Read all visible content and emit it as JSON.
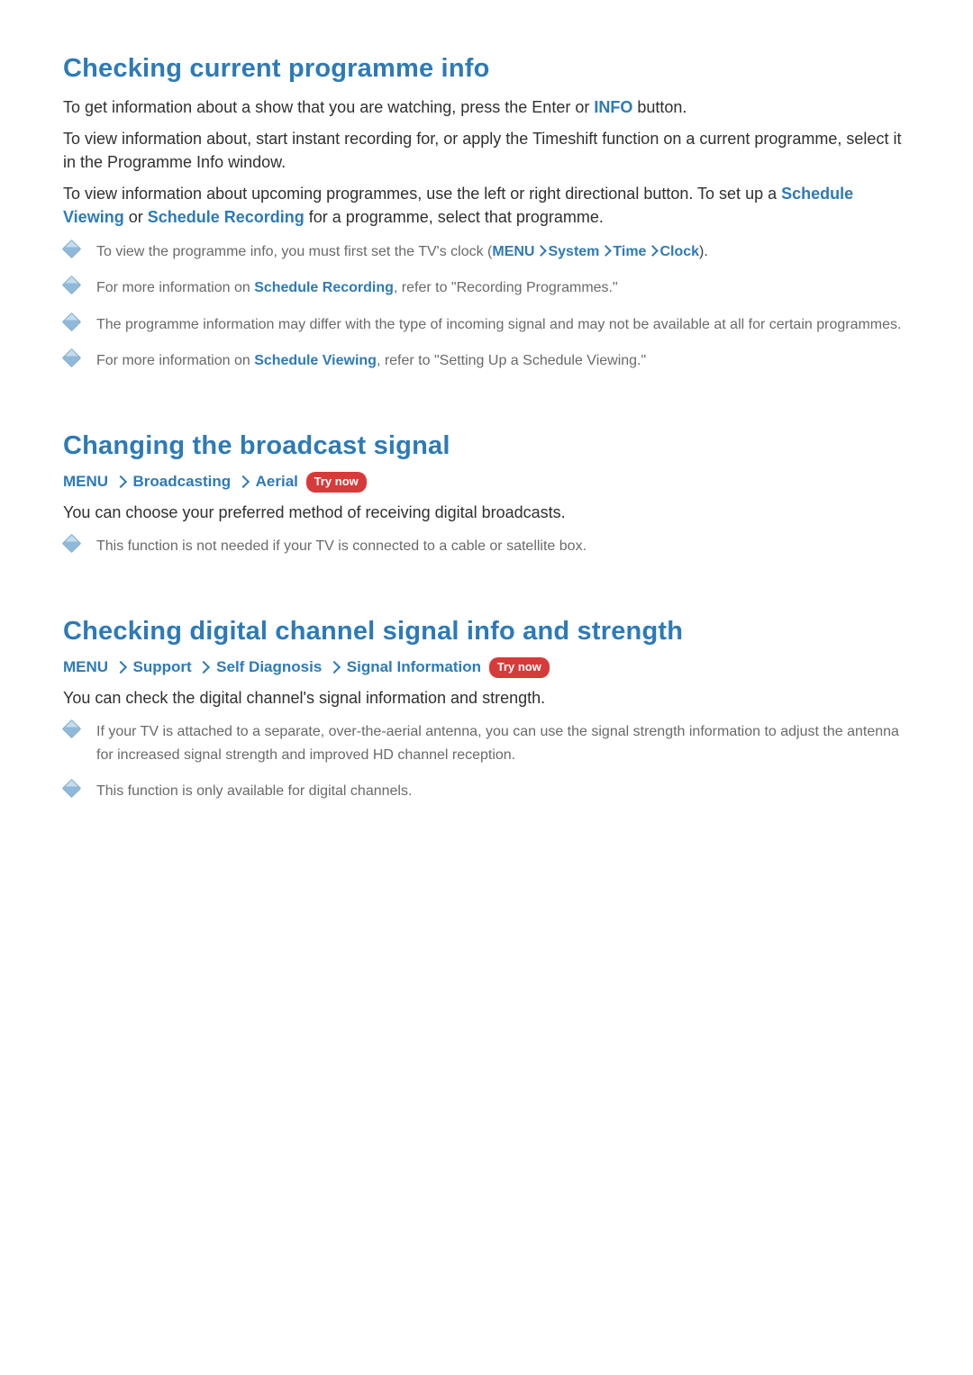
{
  "try_now_label": "Try now",
  "section1": {
    "title": "Checking current programme info",
    "p1_a": "To get information about a show that you are watching, press the Enter or ",
    "p1_info": "INFO",
    "p1_b": " button.",
    "p2": "To view information about, start instant recording for, or apply the Timeshift function on a current programme, select it in the Programme Info window.",
    "p3_a": "To view information about upcoming programmes, use the left or right directional button. To set up a ",
    "p3_sv": "Schedule Viewing",
    "p3_b": " or ",
    "p3_sr": "Schedule Recording",
    "p3_c": " for a programme, select that programme.",
    "notes": {
      "n1_a": "To view the programme info, you must first set the TV's clock (",
      "n1_menu": "MENU",
      "n1_system": "System",
      "n1_time": "Time",
      "n1_clock": "Clock",
      "n1_b": ").",
      "n2_a": "For more information on ",
      "n2_link": "Schedule Recording",
      "n2_b": ", refer to \"Recording Programmes.\"",
      "n3": "The programme information may differ with the type of incoming signal and may not be available at all for certain programmes.",
      "n4_a": "For more information on ",
      "n4_link": "Schedule Viewing",
      "n4_b": ", refer to \"Setting Up a Schedule Viewing.\""
    }
  },
  "section2": {
    "title": "Changing the broadcast signal",
    "path": {
      "menu": "MENU",
      "p1": "Broadcasting",
      "p2": "Aerial"
    },
    "desc": "You can choose your preferred method of receiving digital broadcasts.",
    "notes": {
      "n1": "This function is not needed if your TV is connected to a cable or satellite box."
    }
  },
  "section3": {
    "title": "Checking digital channel signal info and strength",
    "path": {
      "menu": "MENU",
      "p1": "Support",
      "p2": "Self Diagnosis",
      "p3": "Signal Information"
    },
    "desc": "You can check the digital channel's signal information and strength.",
    "notes": {
      "n1": "If your TV is attached to a separate, over-the-aerial antenna, you can use the signal strength information to adjust the antenna for increased signal strength and improved HD channel reception.",
      "n2": "This function is only available for digital channels."
    }
  }
}
